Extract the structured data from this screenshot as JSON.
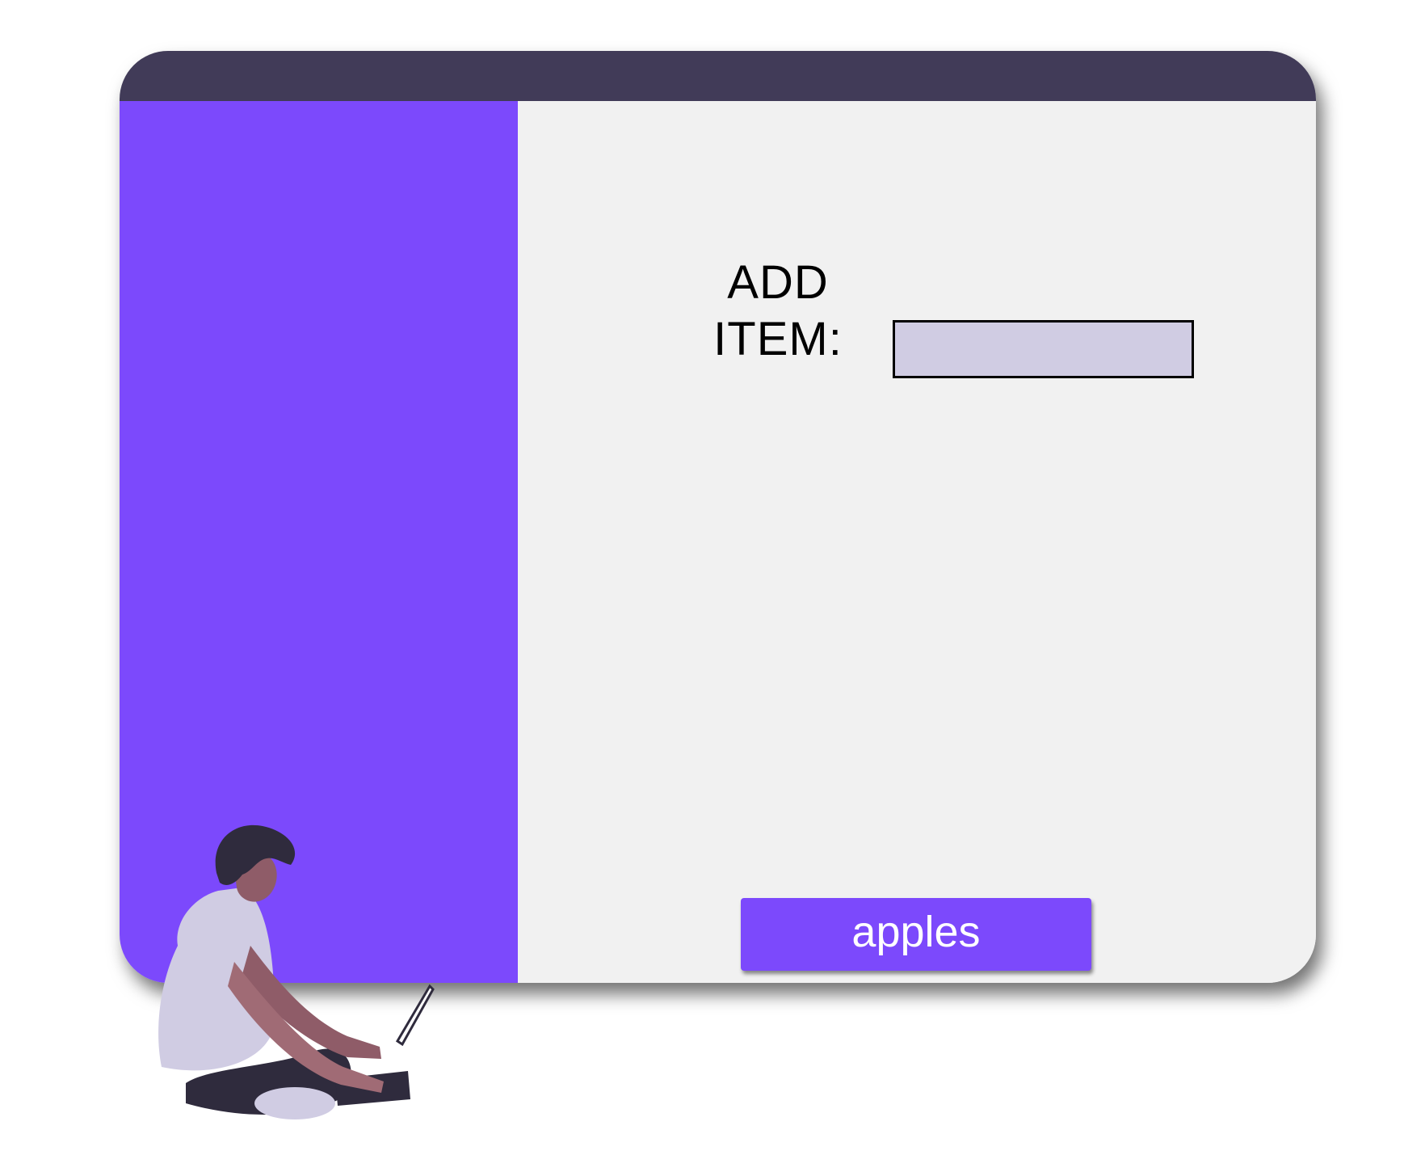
{
  "form": {
    "label_line1": "ADD",
    "label_line2": "ITEM:",
    "input_value": ""
  },
  "items": [
    {
      "label": "apples"
    }
  ],
  "colors": {
    "titlebar": "#413b58",
    "accent": "#7c49fc",
    "panel": "#f1f1f1",
    "input_bg": "#d0cce3"
  },
  "illustration": "person-with-laptop-illustration"
}
